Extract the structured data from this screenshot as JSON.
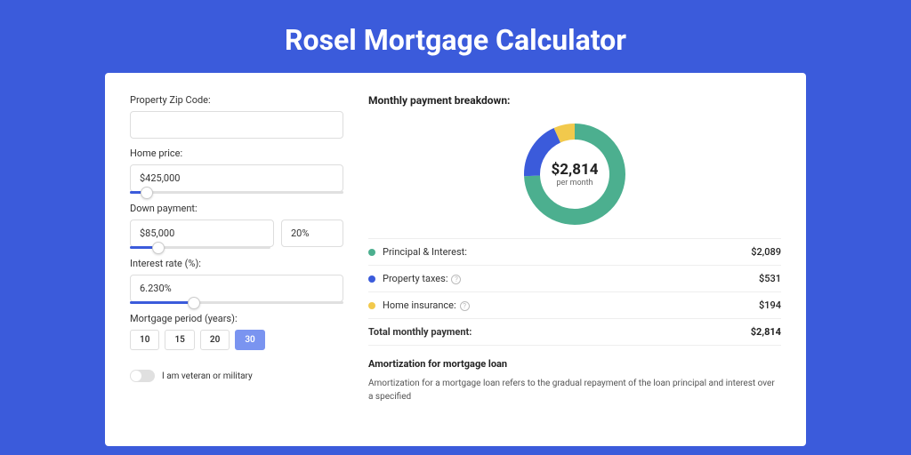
{
  "title": "Rosel Mortgage Calculator",
  "form": {
    "zip_label": "Property Zip Code:",
    "zip_value": "",
    "price_label": "Home price:",
    "price_value": "$425,000",
    "price_slider_pct": 8,
    "down_label": "Down payment:",
    "down_value": "$85,000",
    "down_pct_value": "20%",
    "down_slider_pct": 20,
    "rate_label": "Interest rate (%):",
    "rate_value": "6.230%",
    "rate_slider_pct": 30,
    "period_label": "Mortgage period (years):",
    "period_options": [
      "10",
      "15",
      "20",
      "30"
    ],
    "period_selected": "30",
    "veteran_label": "I am veteran or military",
    "veteran_on": false
  },
  "breakdown": {
    "title": "Monthly payment breakdown:",
    "center_amount": "$2,814",
    "center_sub": "per month",
    "items": [
      {
        "name": "Principal & Interest:",
        "value": "$2,089",
        "color": "#4caf8f",
        "has_info": false
      },
      {
        "name": "Property taxes:",
        "value": "$531",
        "color": "#3b5bdb",
        "has_info": true
      },
      {
        "name": "Home insurance:",
        "value": "$194",
        "color": "#f2c94c",
        "has_info": true
      }
    ],
    "total_label": "Total monthly payment:",
    "total_value": "$2,814"
  },
  "chart_data": {
    "type": "pie",
    "title": "Monthly payment breakdown",
    "series": [
      {
        "name": "Principal & Interest",
        "value": 2089,
        "color": "#4caf8f"
      },
      {
        "name": "Property taxes",
        "value": 531,
        "color": "#3b5bdb"
      },
      {
        "name": "Home insurance",
        "value": 194,
        "color": "#f2c94c"
      }
    ],
    "total": 2814
  },
  "amort": {
    "title": "Amortization for mortgage loan",
    "text": "Amortization for a mortgage loan refers to the gradual repayment of the loan principal and interest over a specified"
  }
}
